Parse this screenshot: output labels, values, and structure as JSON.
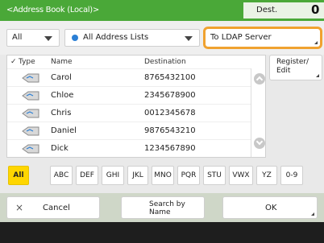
{
  "header": {
    "title": "<Address Book (Local)>",
    "dest_label": "Dest.",
    "dest_count": "0"
  },
  "filters": {
    "type_select": "All",
    "list_select": "All Address Lists",
    "ldap_button": "To LDAP Server"
  },
  "list": {
    "columns": [
      "Type",
      "Name",
      "Destination"
    ],
    "rows": [
      {
        "name": "Carol",
        "destination": "8765432100",
        "icon": "address-entry-icon"
      },
      {
        "name": "Chloe",
        "destination": "2345678900",
        "icon": "address-entry-icon"
      },
      {
        "name": "Chris",
        "destination": "0012345678",
        "icon": "address-entry-icon"
      },
      {
        "name": "Daniel",
        "destination": "9876543210",
        "icon": "address-entry-icon"
      },
      {
        "name": "Dick",
        "destination": "1234567890",
        "icon": "address-entry-icon"
      }
    ]
  },
  "register_button": "Register/\nEdit",
  "index_keys": [
    "All",
    "ABC",
    "DEF",
    "GHI",
    "JKL",
    "MNO",
    "PQR",
    "STU",
    "VWX",
    "YZ",
    "0-9"
  ],
  "bottom": {
    "cancel": "Cancel",
    "search": "Search by\nName",
    "ok": "OK"
  },
  "colors": {
    "header": "#4aa838",
    "highlight": "#f0a230",
    "active_key": "#ffd600"
  }
}
